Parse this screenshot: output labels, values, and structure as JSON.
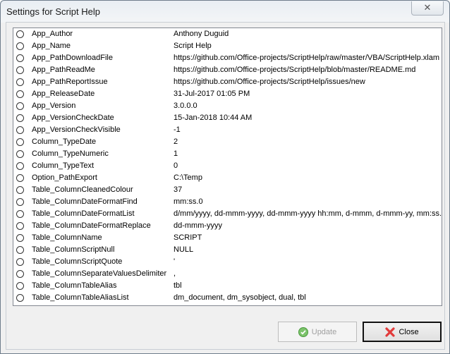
{
  "window": {
    "title": "Settings for Script Help",
    "close_glyph": "✕"
  },
  "settings": [
    {
      "name": "App_Author",
      "value": "Anthony Duguid"
    },
    {
      "name": "App_Name",
      "value": "Script Help"
    },
    {
      "name": "App_PathDownloadFile",
      "value": "https://github.com/Office-projects/ScriptHelp/raw/master/VBA/ScriptHelp.xlam"
    },
    {
      "name": "App_PathReadMe",
      "value": "https://github.com/Office-projects/ScriptHelp/blob/master/README.md"
    },
    {
      "name": "App_PathReportIssue",
      "value": "https://github.com/Office-projects/ScriptHelp/issues/new"
    },
    {
      "name": "App_ReleaseDate",
      "value": "31-Jul-2017 01:05 PM"
    },
    {
      "name": "App_Version",
      "value": "3.0.0.0"
    },
    {
      "name": "App_VersionCheckDate",
      "value": "15-Jan-2018 10:44 AM"
    },
    {
      "name": "App_VersionCheckVisible",
      "value": "-1"
    },
    {
      "name": "Column_TypeDate",
      "value": "2"
    },
    {
      "name": "Column_TypeNumeric",
      "value": "1"
    },
    {
      "name": "Column_TypeText",
      "value": "0"
    },
    {
      "name": "Option_PathExport",
      "value": "C:\\Temp"
    },
    {
      "name": "Table_ColumnCleanedColour",
      "value": "37"
    },
    {
      "name": "Table_ColumnDateFormatFind",
      "value": "mm:ss.0"
    },
    {
      "name": "Table_ColumnDateFormatList",
      "value": "d/mm/yyyy, dd-mmm-yyyy, dd-mmm-yyyy hh:mm, d-mmm, d-mmm-yy, mm:ss."
    },
    {
      "name": "Table_ColumnDateFormatReplace",
      "value": "dd-mmm-yyyy"
    },
    {
      "name": "Table_ColumnName",
      "value": "SCRIPT"
    },
    {
      "name": "Table_ColumnScriptNull",
      "value": "NULL"
    },
    {
      "name": "Table_ColumnScriptQuote",
      "value": "'"
    },
    {
      "name": "Table_ColumnSeparateValuesDelimiter",
      "value": ","
    },
    {
      "name": "Table_ColumnTableAlias",
      "value": "tbl"
    },
    {
      "name": "Table_ColumnTableAliasList",
      "value": "dm_document, dm_sysobject, dual, tbl"
    }
  ],
  "buttons": {
    "update": "Update",
    "close": "Close",
    "update_enabled": false
  },
  "icons": {
    "update": "check-circle-icon",
    "close": "red-x-icon"
  }
}
